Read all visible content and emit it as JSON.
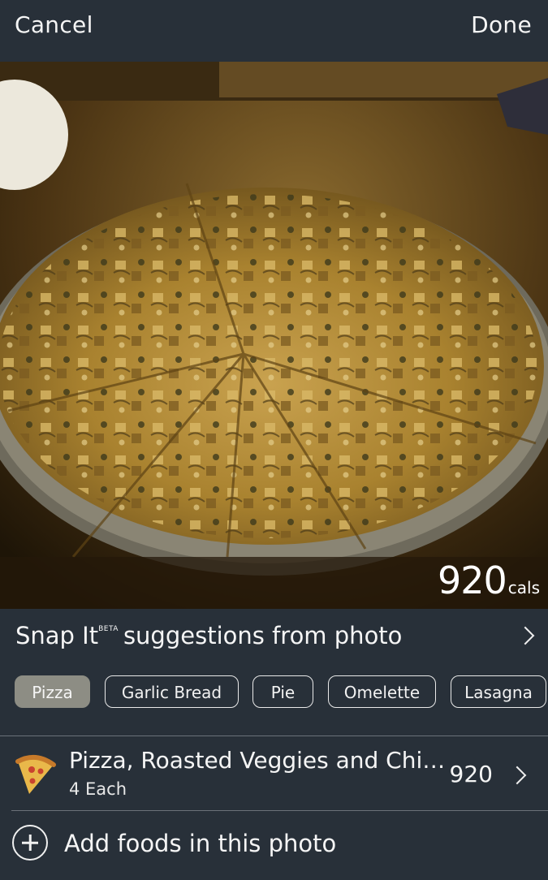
{
  "nav": {
    "cancel_label": "Cancel",
    "done_label": "Done"
  },
  "photo": {
    "calories_value": "920",
    "calories_unit": "cals"
  },
  "snap": {
    "title_main": "Snap It",
    "title_sup": "BETA",
    "title_rest": "suggestions from photo"
  },
  "chips": [
    {
      "label": "Pizza",
      "selected": true
    },
    {
      "label": "Garlic Bread",
      "selected": false
    },
    {
      "label": "Pie",
      "selected": false
    },
    {
      "label": "Omelette",
      "selected": false
    },
    {
      "label": "Lasagna",
      "selected": false
    }
  ],
  "food": {
    "name": "Pizza, Roasted Veggies and Chi…",
    "quantity": "4 Each",
    "calories": "920",
    "icon": "pizza-icon"
  },
  "add": {
    "label": "Add foods in this photo",
    "icon": "plus-circle-icon"
  },
  "colors": {
    "background": "#283039",
    "chip_selected": "#8d8d84",
    "divider": "#6b7179"
  }
}
